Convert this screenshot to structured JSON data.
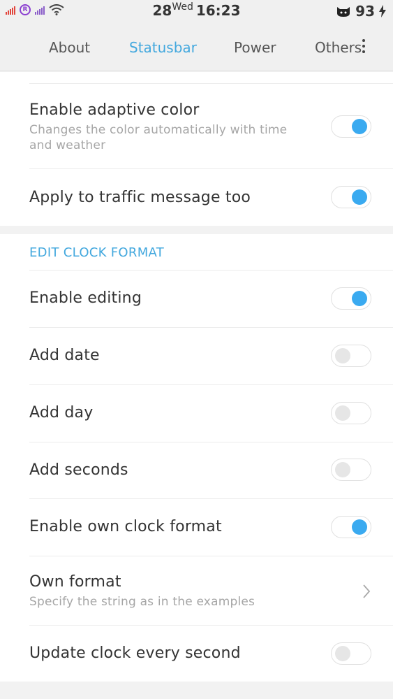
{
  "status_bar": {
    "date": "28",
    "day": "Wed",
    "time": "16:23",
    "battery": "93",
    "icons": [
      "signal-icon",
      "roaming-icon",
      "signal-icon",
      "wifi-icon",
      "cat-icon",
      "charging-bolt-icon"
    ]
  },
  "tabs": [
    {
      "label": "About",
      "active": false
    },
    {
      "label": "Statusbar",
      "active": true
    },
    {
      "label": "Power",
      "active": false
    },
    {
      "label": "Others",
      "active": false
    }
  ],
  "colors": {
    "accent": "#43a8de",
    "toggle_on": "#3aaaf0",
    "summary_text": "#a6a6a6"
  },
  "section1": {
    "items": [
      {
        "title": "Enable adaptive color",
        "summary": "Changes the color automatically with time and weather",
        "toggle": "on"
      },
      {
        "title": "Apply to traffic message too",
        "toggle": "on"
      }
    ]
  },
  "section2": {
    "header": "EDIT CLOCK FORMAT",
    "items": [
      {
        "title": "Enable editing",
        "toggle": "on"
      },
      {
        "title": "Add date",
        "toggle": "off"
      },
      {
        "title": "Add day",
        "toggle": "off"
      },
      {
        "title": "Add seconds",
        "toggle": "off"
      },
      {
        "title": "Enable own clock format",
        "toggle": "on"
      },
      {
        "title": "Own format",
        "summary": "Specify the string as in the examples",
        "control": "chevron"
      },
      {
        "title": "Update clock every second",
        "toggle": "off"
      }
    ]
  }
}
